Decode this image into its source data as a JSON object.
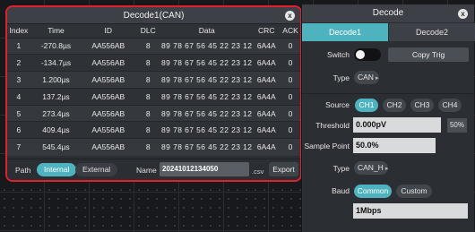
{
  "decode_window": {
    "title": "Decode1(CAN)",
    "close": "x",
    "columns": [
      "Index",
      "Time",
      "ID",
      "DLC",
      "Data",
      "CRC",
      "ACK"
    ],
    "rows": [
      [
        "1",
        "-270.8µs",
        "AA556AB",
        "8",
        "89 78 67 56 45 22 23 12",
        "6A4A",
        "0"
      ],
      [
        "2",
        "-134.7µs",
        "AA556AB",
        "8",
        "89 78 67 56 45 22 23 12",
        "6A4A",
        "0"
      ],
      [
        "3",
        "1.200µs",
        "AA556AB",
        "8",
        "89 78 67 56 45 22 23 12",
        "6A4A",
        "0"
      ],
      [
        "4",
        "137.2µs",
        "AA556AB",
        "8",
        "89 78 67 56 45 22 23 12",
        "6A4A",
        "0"
      ],
      [
        "5",
        "273.4µs",
        "AA556AB",
        "8",
        "89 78 67 56 45 22 23 12",
        "6A4A",
        "0"
      ],
      [
        "6",
        "409.4µs",
        "AA556AB",
        "8",
        "89 78 67 56 45 22 23 12",
        "6A4A",
        "0"
      ],
      [
        "7",
        "545.4µs",
        "AA556AB",
        "8",
        "89 78 67 56 45 22 23 12",
        "6A4A",
        "0"
      ]
    ],
    "footer": {
      "path_label": "Path",
      "internal_label": "Internal",
      "external_label": "External",
      "name_label": "Name",
      "name_value": "20241012134050",
      "extension": ".csv",
      "export_label": "Export"
    }
  },
  "decode_panel": {
    "title": "Decode",
    "close": "x",
    "tabs": [
      "Decode1",
      "Decode2"
    ],
    "switch_label": "Switch",
    "copy_trig_label": "Copy Trig",
    "type_label": "Type",
    "type_value": "CAN",
    "source_label": "Source",
    "source_options": [
      "CH1",
      "CH2",
      "CH3",
      "CH4"
    ],
    "source_selected": "CH1",
    "threshold_label": "Threshold",
    "threshold_value": "0.000pV",
    "threshold_unit": "50%",
    "sample_point_label": "Sample Point",
    "sample_point_value": "50.0%",
    "signal_type_label": "Type",
    "signal_type_value": "CAN_H",
    "baud_label": "Baud",
    "baud_options": [
      "Common",
      "Custom"
    ],
    "baud_value": "1Mbps"
  },
  "colors": {
    "accent": "#4fb3bf",
    "highlight_border": "#e0202a"
  }
}
